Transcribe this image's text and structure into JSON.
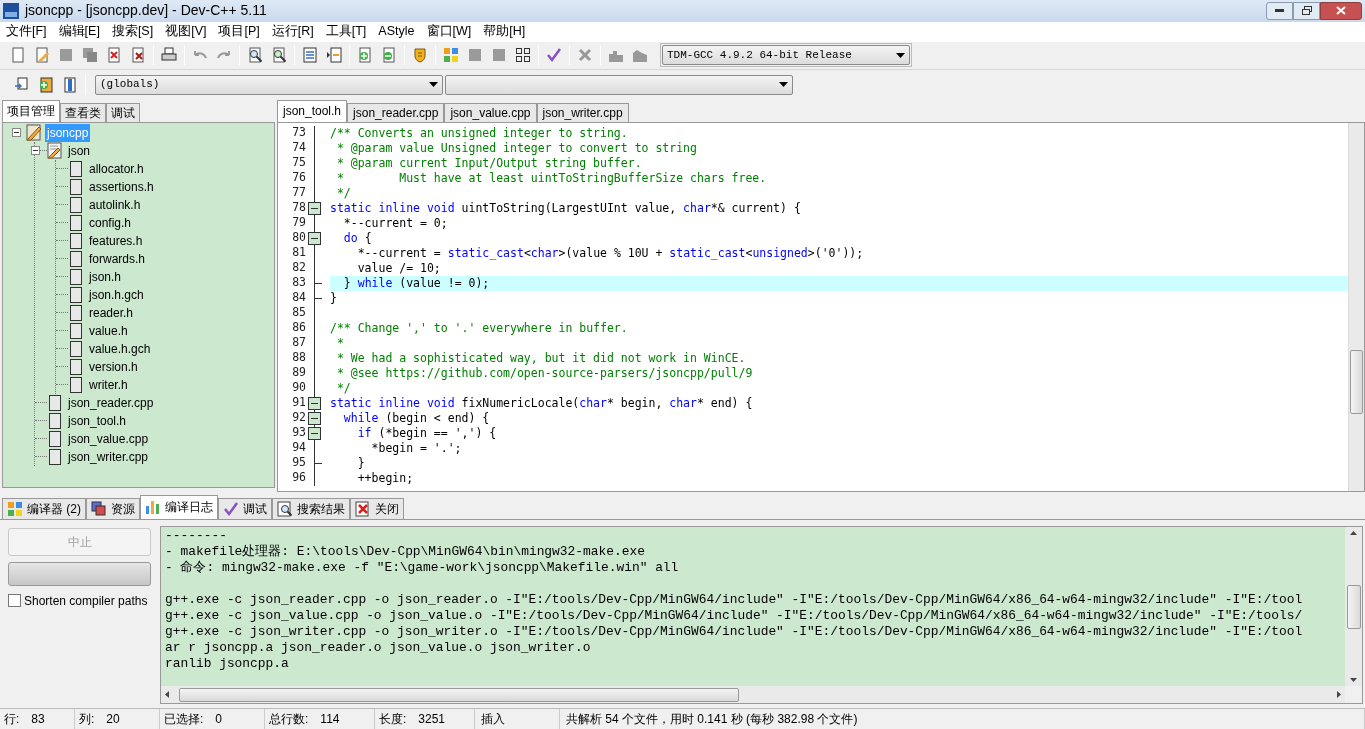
{
  "window": {
    "title": "jsoncpp - [jsoncpp.dev] - Dev-C++ 5.11"
  },
  "menu": [
    "文件[F]",
    "编辑[E]",
    "搜索[S]",
    "视图[V]",
    "项目[P]",
    "运行[R]",
    "工具[T]",
    "AStyle",
    "窗口[W]",
    "帮助[H]"
  ],
  "toolbar": {
    "compiler_select": "TDM-GCC 4.9.2 64-bit Release",
    "scope_select": "(globals)"
  },
  "project_tabs": [
    {
      "label": "项目管理",
      "selected": true
    },
    {
      "label": "查看类",
      "selected": false
    },
    {
      "label": "调试",
      "selected": false
    }
  ],
  "project_tree": [
    {
      "label": "jsoncpp",
      "kind": "project",
      "selected": true,
      "expanded": true,
      "children": [
        {
          "label": "json",
          "kind": "folder",
          "selected": false,
          "expanded": true,
          "children": [
            {
              "label": "allocator.h",
              "kind": "file",
              "selected": false
            },
            {
              "label": "assertions.h",
              "kind": "file",
              "selected": false
            },
            {
              "label": "autolink.h",
              "kind": "file",
              "selected": false
            },
            {
              "label": "config.h",
              "kind": "file",
              "selected": false
            },
            {
              "label": "features.h",
              "kind": "file",
              "selected": false
            },
            {
              "label": "forwards.h",
              "kind": "file",
              "selected": false
            },
            {
              "label": "json.h",
              "kind": "file",
              "selected": false
            },
            {
              "label": "json.h.gch",
              "kind": "file",
              "selected": false
            },
            {
              "label": "reader.h",
              "kind": "file",
              "selected": false
            },
            {
              "label": "value.h",
              "kind": "file",
              "selected": false
            },
            {
              "label": "value.h.gch",
              "kind": "file",
              "selected": false
            },
            {
              "label": "version.h",
              "kind": "file",
              "selected": false
            },
            {
              "label": "writer.h",
              "kind": "file",
              "selected": false
            }
          ]
        },
        {
          "label": "json_reader.cpp",
          "kind": "file",
          "selected": false
        },
        {
          "label": "json_tool.h",
          "kind": "file",
          "selected": false
        },
        {
          "label": "json_value.cpp",
          "kind": "file",
          "selected": false
        },
        {
          "label": "json_writer.cpp",
          "kind": "file",
          "selected": false
        }
      ]
    }
  ],
  "editor_tabs": [
    {
      "label": "json_tool.h",
      "selected": true
    },
    {
      "label": "json_reader.cpp",
      "selected": false
    },
    {
      "label": "json_value.cpp",
      "selected": false
    },
    {
      "label": "json_writer.cpp",
      "selected": false
    }
  ],
  "code_lines": [
    {
      "number": "73",
      "kind": "plain",
      "highlighted": false,
      "tokens": [
        {
          "kind": "comment",
          "text": "/** Converts an unsigned integer to string."
        }
      ]
    },
    {
      "number": "74",
      "kind": "plain",
      "highlighted": false,
      "tokens": [
        {
          "kind": "comment",
          "text": " * @param value Unsigned integer to convert to string"
        }
      ]
    },
    {
      "number": "75",
      "kind": "plain",
      "highlighted": false,
      "tokens": [
        {
          "kind": "comment",
          "text": " * @param current Input/Output string buffer."
        }
      ]
    },
    {
      "number": "76",
      "kind": "plain",
      "highlighted": false,
      "tokens": [
        {
          "kind": "comment",
          "text": " *        Must have at least uintToStringBufferSize chars free."
        }
      ]
    },
    {
      "number": "77",
      "kind": "plain",
      "highlighted": false,
      "tokens": [
        {
          "kind": "comment",
          "text": " */"
        }
      ]
    },
    {
      "number": "78",
      "kind": "fold_start",
      "highlighted": false,
      "tokens": [
        {
          "kind": "keyword",
          "text": "static inline void"
        },
        {
          "kind": "text",
          "text": " uintToString(LargestUInt value, "
        },
        {
          "kind": "keyword",
          "text": "char"
        },
        {
          "kind": "text",
          "text": "*& current) {"
        }
      ]
    },
    {
      "number": "79",
      "kind": "plain",
      "highlighted": false,
      "tokens": [
        {
          "kind": "text",
          "text": "  *--current = 0;"
        }
      ]
    },
    {
      "number": "80",
      "kind": "fold_start",
      "highlighted": false,
      "tokens": [
        {
          "kind": "keyword",
          "text": "  do"
        },
        {
          "kind": "text",
          "text": " {"
        }
      ]
    },
    {
      "number": "81",
      "kind": "plain",
      "highlighted": false,
      "tokens": [
        {
          "kind": "text",
          "text": "    *--current = "
        },
        {
          "kind": "keyword",
          "text": "static_cast"
        },
        {
          "kind": "text",
          "text": "<"
        },
        {
          "kind": "keyword",
          "text": "char"
        },
        {
          "kind": "text",
          "text": ">(value % 10U + "
        },
        {
          "kind": "keyword",
          "text": "static_cast"
        },
        {
          "kind": "text",
          "text": "<"
        },
        {
          "kind": "keyword",
          "text": "unsigned"
        },
        {
          "kind": "text",
          "text": ">('0'));"
        }
      ]
    },
    {
      "number": "82",
      "kind": "plain",
      "highlighted": false,
      "tokens": [
        {
          "kind": "text",
          "text": "    value /= 10;"
        }
      ]
    },
    {
      "number": "83",
      "kind": "fold_end",
      "highlighted": true,
      "tokens": [
        {
          "kind": "text",
          "text": "  } "
        },
        {
          "kind": "keyword",
          "text": "while"
        },
        {
          "kind": "text",
          "text": " (value != 0);"
        }
      ]
    },
    {
      "number": "84",
      "kind": "fold_end",
      "highlighted": false,
      "tokens": [
        {
          "kind": "text",
          "text": "}"
        }
      ]
    },
    {
      "number": "85",
      "kind": "plain",
      "highlighted": false
    },
    {
      "number": "86",
      "kind": "plain",
      "highlighted": false,
      "tokens": [
        {
          "kind": "comment",
          "text": "/** Change ',' to '.' everywhere in buffer."
        }
      ]
    },
    {
      "number": "87",
      "kind": "plain",
      "highlighted": false,
      "tokens": [
        {
          "kind": "comment",
          "text": " *"
        }
      ]
    },
    {
      "number": "88",
      "kind": "plain",
      "highlighted": false,
      "tokens": [
        {
          "kind": "comment",
          "text": " * We had a sophisticated way, but it did not work in WinCE."
        }
      ]
    },
    {
      "number": "89",
      "kind": "plain",
      "highlighted": false,
      "tokens": [
        {
          "kind": "comment",
          "text": " * @see https://github.com/open-source-parsers/jsoncpp/pull/9"
        }
      ]
    },
    {
      "number": "90",
      "kind": "plain",
      "highlighted": false,
      "tokens": [
        {
          "kind": "comment",
          "text": " */"
        }
      ]
    },
    {
      "number": "91",
      "kind": "fold_start",
      "highlighted": false,
      "tokens": [
        {
          "kind": "keyword",
          "text": "static inline void"
        },
        {
          "kind": "text",
          "text": " fixNumericLocale("
        },
        {
          "kind": "keyword",
          "text": "char"
        },
        {
          "kind": "text",
          "text": "* begin, "
        },
        {
          "kind": "keyword",
          "text": "char"
        },
        {
          "kind": "text",
          "text": "* end) {"
        }
      ]
    },
    {
      "number": "92",
      "kind": "fold_start",
      "highlighted": false,
      "tokens": [
        {
          "kind": "keyword",
          "text": "  while"
        },
        {
          "kind": "text",
          "text": " (begin < end) {"
        }
      ]
    },
    {
      "number": "93",
      "kind": "fold_start",
      "highlighted": false,
      "tokens": [
        {
          "kind": "keyword",
          "text": "    if"
        },
        {
          "kind": "text",
          "text": " (*begin == ',') {"
        }
      ]
    },
    {
      "number": "94",
      "kind": "plain",
      "highlighted": false,
      "tokens": [
        {
          "kind": "text",
          "text": "      *begin = '.';"
        }
      ]
    },
    {
      "number": "95",
      "kind": "fold_end",
      "highlighted": false,
      "tokens": [
        {
          "kind": "text",
          "text": "    }"
        }
      ]
    },
    {
      "number": "96",
      "kind": "plain",
      "highlighted": false,
      "tokens": [
        {
          "kind": "text",
          "text": "    ++begin;"
        }
      ]
    }
  ],
  "bottom_tabs": [
    {
      "label": "编译器 (2)",
      "selected": false
    },
    {
      "label": "资源",
      "selected": false
    },
    {
      "label": "编译日志",
      "selected": true
    },
    {
      "label": "调试",
      "selected": false
    },
    {
      "label": "搜索结果",
      "selected": false
    },
    {
      "label": "关闭",
      "selected": false
    }
  ],
  "compile_panel": {
    "abort_button": {
      "label": "中止",
      "disabled": true
    },
    "progress": {
      "level": 0
    },
    "shorten_paths": {
      "label": "Shorten compiler paths",
      "checked": false
    },
    "log": [
      {
        "text": "--------",
        "blank_before": false
      },
      {
        "text": "- makefile处理器: E:\\tools\\Dev-Cpp\\MinGW64\\bin\\mingw32-make.exe",
        "blank_before": false
      },
      {
        "text": "- 命令: mingw32-make.exe -f \"E:\\game-work\\jsoncpp\\Makefile.win\" all",
        "blank_before": false
      },
      {
        "text": "g++.exe -c json_reader.cpp -o json_reader.o -I\"E:/tools/Dev-Cpp/MinGW64/include\" -I\"E:/tools/Dev-Cpp/MinGW64/x86_64-w64-mingw32/include\" -I\"E:/tool",
        "blank_before": true
      },
      {
        "text": "g++.exe -c json_value.cpp -o json_value.o -I\"E:/tools/Dev-Cpp/MinGW64/include\" -I\"E:/tools/Dev-Cpp/MinGW64/x86_64-w64-mingw32/include\" -I\"E:/tools/",
        "blank_before": false
      },
      {
        "text": "g++.exe -c json_writer.cpp -o json_writer.o -I\"E:/tools/Dev-Cpp/MinGW64/include\" -I\"E:/tools/Dev-Cpp/MinGW64/x86_64-w64-mingw32/include\" -I\"E:/tool",
        "blank_before": false
      },
      {
        "text": "ar r jsoncpp.a json_reader.o json_value.o json_writer.o",
        "blank_before": false
      },
      {
        "text": "ranlib jsoncpp.a",
        "blank_before": false
      }
    ]
  },
  "status_bar": [
    {
      "label": "行:",
      "value": "83"
    },
    {
      "label": "列:",
      "value": "20"
    },
    {
      "label": "已选择:",
      "value": "0"
    },
    {
      "label": "总行数:",
      "value": "114"
    },
    {
      "label": "长度:",
      "value": "3251"
    },
    {
      "value": "插入"
    },
    {
      "value": "共解析 54 个文件，用时 0.141 秒 (每秒 382.98 个文件)"
    }
  ]
}
